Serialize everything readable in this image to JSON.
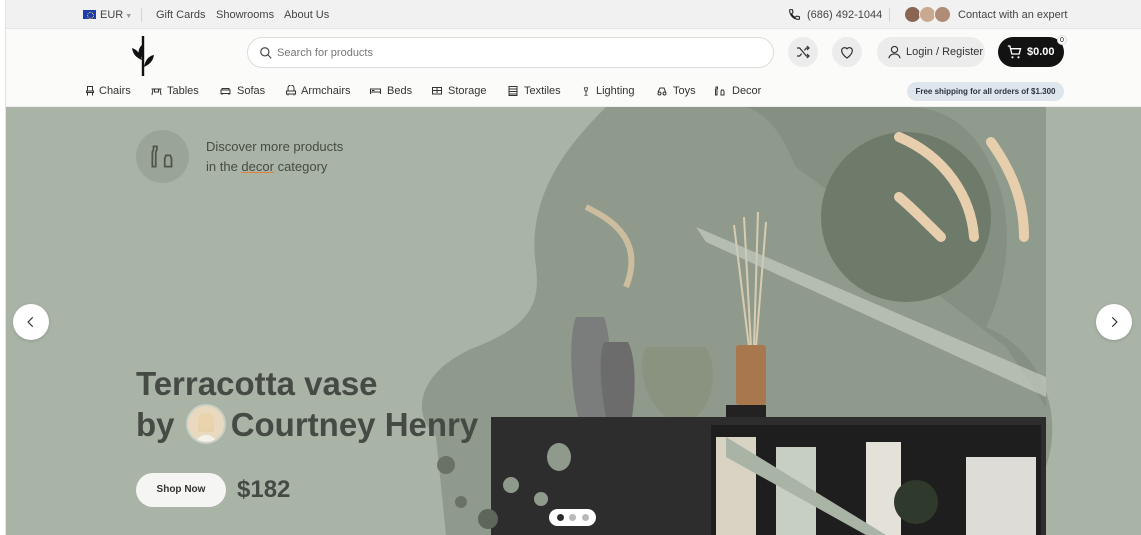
{
  "topbar": {
    "currency": "EUR",
    "links": [
      "Gift Cards",
      "Showrooms",
      "About Us"
    ],
    "phone": "(686) 492-1044",
    "expert_label": "Contact with an expert"
  },
  "header": {
    "search_placeholder": "Search for products",
    "login_label": "Login / Register",
    "cart_total": "$0.00",
    "cart_count": "0"
  },
  "nav": {
    "items": [
      {
        "label": "Chairs",
        "icon": "chair-icon"
      },
      {
        "label": "Tables",
        "icon": "table-icon"
      },
      {
        "label": "Sofas",
        "icon": "sofa-icon"
      },
      {
        "label": "Armchairs",
        "icon": "armchair-icon"
      },
      {
        "label": "Beds",
        "icon": "bed-icon"
      },
      {
        "label": "Storage",
        "icon": "storage-icon"
      },
      {
        "label": "Textiles",
        "icon": "textile-icon"
      },
      {
        "label": "Lighting",
        "icon": "lamp-icon"
      },
      {
        "label": "Toys",
        "icon": "toy-icon"
      },
      {
        "label": "Decor",
        "icon": "vase-icon"
      }
    ],
    "shipping_note": "Free shipping for all orders of $1.300"
  },
  "hero": {
    "discover_line1": "Discover more products",
    "discover_line2_pre": "in the ",
    "discover_line2_link": "decor",
    "discover_line2_post": " category",
    "headline_line1": "Terracotta vase",
    "headline_by": "by",
    "headline_name": "Courtney Henry",
    "cta_label": "Shop Now",
    "price": "$182",
    "slides_total": 3,
    "slide_active": 1
  },
  "colors": {
    "hero_bg": "#a9b3a6",
    "accent_dark": "#121212",
    "shipping_badge": "#dfe5ec"
  }
}
